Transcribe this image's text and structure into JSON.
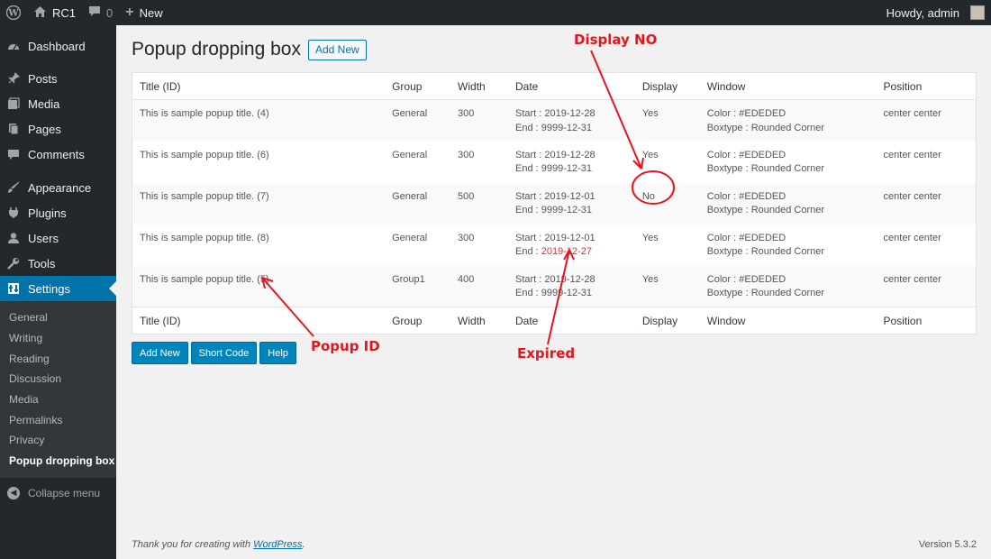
{
  "adminbar": {
    "site_name": "RC1",
    "comments_count": "0",
    "new_label": "New",
    "howdy": "Howdy, admin"
  },
  "sidebar": {
    "items": [
      {
        "label": "Dashboard",
        "icon": "dashboard-icon"
      },
      {
        "label": "Posts",
        "icon": "pin-icon"
      },
      {
        "label": "Media",
        "icon": "media-icon"
      },
      {
        "label": "Pages",
        "icon": "pages-icon"
      },
      {
        "label": "Comments",
        "icon": "comment-icon"
      },
      {
        "label": "Appearance",
        "icon": "brush-icon"
      },
      {
        "label": "Plugins",
        "icon": "plug-icon"
      },
      {
        "label": "Users",
        "icon": "user-icon"
      },
      {
        "label": "Tools",
        "icon": "wrench-icon"
      },
      {
        "label": "Settings",
        "icon": "settings-icon"
      }
    ],
    "submenu": [
      "General",
      "Writing",
      "Reading",
      "Discussion",
      "Media",
      "Permalinks",
      "Privacy",
      "Popup dropping box"
    ],
    "collapse_label": "Collapse menu"
  },
  "page": {
    "title": "Popup dropping box",
    "add_new": "Add New"
  },
  "table": {
    "columns": [
      "Title (ID)",
      "Group",
      "Width",
      "Date",
      "Display",
      "Window",
      "Position"
    ],
    "rows": [
      {
        "title": "This is sample popup title. (4)",
        "group": "General",
        "width": "300",
        "start": "Start : 2019-12-28",
        "end_label": "End : ",
        "end_value": "9999-12-31",
        "display": "Yes",
        "color": "Color : #EDEDED",
        "boxtype": "Boxtype : Rounded Corner",
        "position": "center center"
      },
      {
        "title": "This is sample popup title. (6)",
        "group": "General",
        "width": "300",
        "start": "Start : 2019-12-28",
        "end_label": "End : ",
        "end_value": "9999-12-31",
        "display": "Yes",
        "color": "Color : #EDEDED",
        "boxtype": "Boxtype : Rounded Corner",
        "position": "center center"
      },
      {
        "title": "This is sample popup title. (7)",
        "group": "General",
        "width": "500",
        "start": "Start : 2019-12-01",
        "end_label": "End : ",
        "end_value": "9999-12-31",
        "display": "No",
        "color": "Color : #EDEDED",
        "boxtype": "Boxtype : Rounded Corner",
        "position": "center center"
      },
      {
        "title": "This is sample popup title. (8)",
        "group": "General",
        "width": "300",
        "start": "Start : 2019-12-01",
        "end_label": "End : ",
        "end_value": "2019-12-27",
        "display": "Yes",
        "color": "Color : #EDEDED",
        "boxtype": "Boxtype : Rounded Corner",
        "position": "center center"
      },
      {
        "title": "This is sample popup title. (5)",
        "group": "Group1",
        "width": "400",
        "start": "Start : 2019-12-28",
        "end_label": "End : ",
        "end_value": "9999-12-31",
        "display": "Yes",
        "color": "Color : #EDEDED",
        "boxtype": "Boxtype : Rounded Corner",
        "position": "center center"
      }
    ]
  },
  "buttons": {
    "add_new": "Add New",
    "short_code": "Short Code",
    "help": "Help"
  },
  "footer": {
    "thanks_prefix": "Thank you for creating with ",
    "wordpress_link": "WordPress",
    "thanks_suffix": ".",
    "version": "Version 5.3.2"
  },
  "annotations": {
    "display_no": "Display NO",
    "popup_id": "Popup ID",
    "expired": "Expired"
  },
  "colors": {
    "accent": "#0073aa",
    "yes": "#008a20",
    "no": "#dc3232",
    "annotation": "#e8141d"
  }
}
